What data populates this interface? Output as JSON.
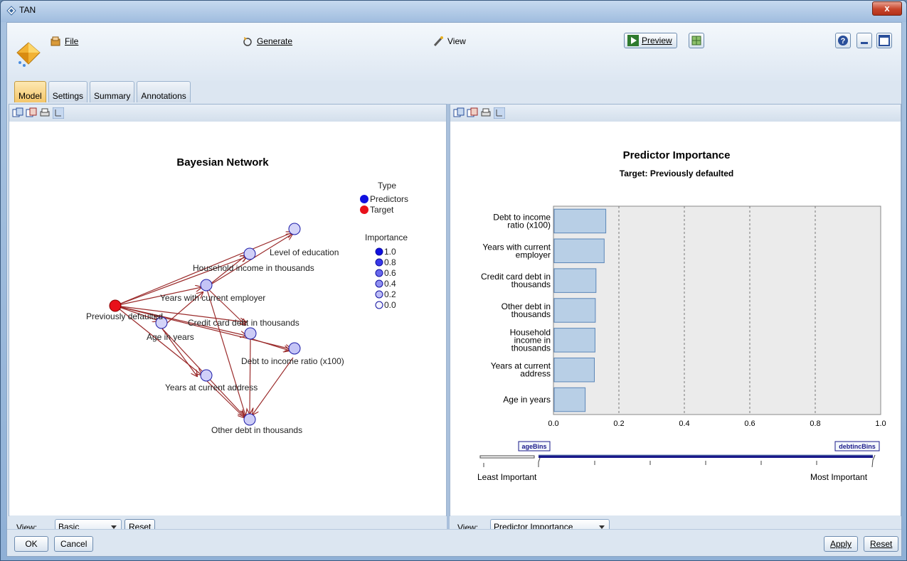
{
  "window": {
    "title": "TAN",
    "close_label": "x"
  },
  "menu": {
    "file": "File",
    "generate": "Generate",
    "view": "View",
    "preview": "Preview"
  },
  "tabs": [
    {
      "label": "Model",
      "active": true
    },
    {
      "label": "Settings",
      "active": false
    },
    {
      "label": "Summary",
      "active": false
    },
    {
      "label": "Annotations",
      "active": false
    }
  ],
  "left_panel": {
    "view_label": "View:",
    "view_value": "Basic",
    "reset_label": "Reset",
    "network": {
      "title": "Bayesian Network",
      "legend_type_title": "Type",
      "legend_types": [
        "Predictors",
        "Target"
      ],
      "legend_importance_title": "Importance",
      "legend_importance": [
        "1.0",
        "0.8",
        "0.6",
        "0.4",
        "0.2",
        "0.0"
      ],
      "nodes": [
        {
          "id": "target",
          "label": "Previously defaulted",
          "type": "target"
        },
        {
          "id": "edu",
          "label": "Level of education",
          "type": "predictor"
        },
        {
          "id": "income",
          "label": "Household income in thousands",
          "type": "predictor"
        },
        {
          "id": "employ",
          "label": "Years with current employer",
          "type": "predictor"
        },
        {
          "id": "age",
          "label": "Age in years",
          "type": "predictor"
        },
        {
          "id": "credit",
          "label": "Credit card debt in thousands",
          "type": "predictor"
        },
        {
          "id": "debtinc",
          "label": "Debt to income ratio (x100)",
          "type": "predictor"
        },
        {
          "id": "address",
          "label": "Years at current address",
          "type": "predictor"
        },
        {
          "id": "other",
          "label": "Other debt in thousands",
          "type": "predictor"
        }
      ]
    }
  },
  "right_panel": {
    "view_label": "View:",
    "view_value": "Predictor Importance"
  },
  "chart_data": {
    "type": "bar",
    "title": "Predictor Importance",
    "subtitle": "Target: Previously defaulted",
    "categories": [
      "Debt to income ratio (x100)",
      "Years with current employer",
      "Credit card debt in thousands",
      "Other debt in thousands",
      "Household income in thousands",
      "Years at current address",
      "Age in years"
    ],
    "category_lines": [
      [
        "Debt to income",
        "ratio (x100)"
      ],
      [
        "Years with current",
        "employer"
      ],
      [
        "Credit card debt in",
        "thousands"
      ],
      [
        "Other debt in",
        "thousands"
      ],
      [
        "Household",
        "income in",
        "thousands"
      ],
      [
        "Years at current",
        "address"
      ],
      [
        "Age in years"
      ]
    ],
    "values": [
      0.16,
      0.155,
      0.13,
      0.128,
      0.127,
      0.125,
      0.097
    ],
    "xlim": [
      0.0,
      1.0
    ],
    "xticks": [
      "0.0",
      "0.2",
      "0.4",
      "0.6",
      "0.8",
      "1.0"
    ],
    "grid": true,
    "slider": {
      "left_tag": "ageBins",
      "right_tag": "debtincBins",
      "left_label": "Least Important",
      "right_label": "Most Important"
    },
    "colors": {
      "bar_fill": "#b8cfe6",
      "bar_stroke": "#5b86b8",
      "plot_bg": "#ebebeb"
    }
  },
  "buttons": {
    "ok": "OK",
    "cancel": "Cancel",
    "apply": "Apply",
    "reset": "Reset"
  }
}
